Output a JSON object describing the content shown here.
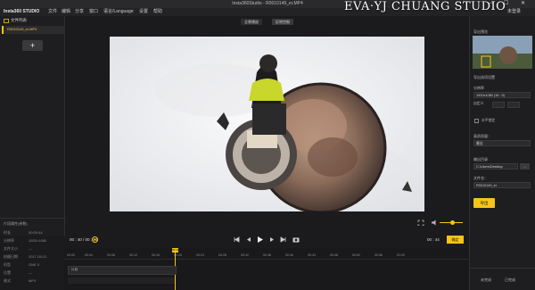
{
  "window": {
    "title": "Insta360Studio - R0010149_er.MP4",
    "min": "—",
    "max": "☐",
    "close": "✕"
  },
  "menu": {
    "brand": "Insta360 STUDIO",
    "items": [
      "文件",
      "编辑",
      "分享",
      "窗口",
      "语言/Language",
      "设置",
      "帮助"
    ],
    "login": "未登录"
  },
  "watermark": "EVA‧YJ CHUANG STUDIO",
  "left": {
    "header": "文件列表",
    "file": "R0010149_er.MP4",
    "add": "+",
    "params_title": "片段属性(参数)",
    "params": [
      {
        "k": "时长",
        "v": "00:00:44"
      },
      {
        "k": "分辨率",
        "v": "1920×1080"
      },
      {
        "k": "文件大小",
        "v": "—"
      },
      {
        "k": "拍摄日期",
        "v": "2017-09-21"
      },
      {
        "k": "机型",
        "v": "ONE X"
      },
      {
        "k": "位置",
        "v": "—"
      },
      {
        "k": "格式",
        "v": "MP4"
      }
    ]
  },
  "preview": {
    "mode1": "全景播放",
    "mode2": "反转控制",
    "time_current": "00 : 40 / 00 : 44",
    "time_right": "00 : 44",
    "done": "确定"
  },
  "timeline": {
    "ticks": [
      "00:00",
      "00:04",
      "00:08",
      "00:12",
      "00:16",
      "00:20",
      "00:24",
      "00:28",
      "00:32",
      "00:36",
      "00:40",
      "00:44",
      "00:48",
      "00:52",
      "00:56",
      "01:00"
    ],
    "playhead_label": "00:40",
    "track_label": "片段"
  },
  "right": {
    "preview_label": "导出预览",
    "export_settings": "导出选项设置",
    "resolution_label": "分辨率",
    "resolution": "1920x1080 (16 : 9)",
    "custom": "自定义",
    "checkbox": "水平锁定",
    "quality_label": "画质质量：",
    "quality": "最佳",
    "path_label": "输出目录",
    "path": "C:\\Users\\Desktop",
    "name_label": "文件名：",
    "name": "R0010149_er",
    "export": "导出",
    "tab1": "未完成",
    "tab2": "已完成"
  },
  "colors": {
    "accent": "#f5c518",
    "bg": "#1b1b1d"
  }
}
